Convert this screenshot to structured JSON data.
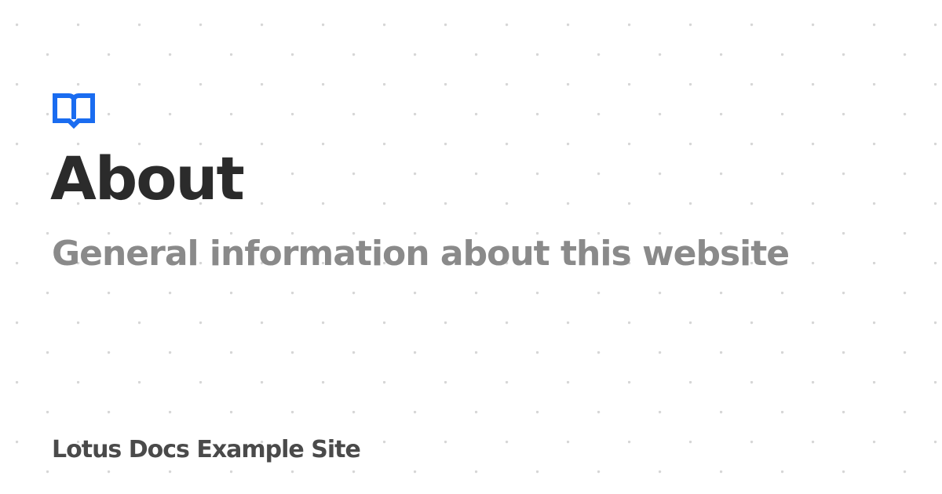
{
  "page": {
    "title": "About",
    "subtitle": "General information about this website",
    "site_name": "Lotus Docs Example Site"
  },
  "logo": {
    "icon": "book-open-icon",
    "color": "#1a6cf0"
  },
  "colors": {
    "background": "#ffffff",
    "dot_pattern": "#d6d6d6",
    "title": "#2b2b2b",
    "subtitle": "#8a8a8a",
    "site_name": "#4a4a4a"
  }
}
